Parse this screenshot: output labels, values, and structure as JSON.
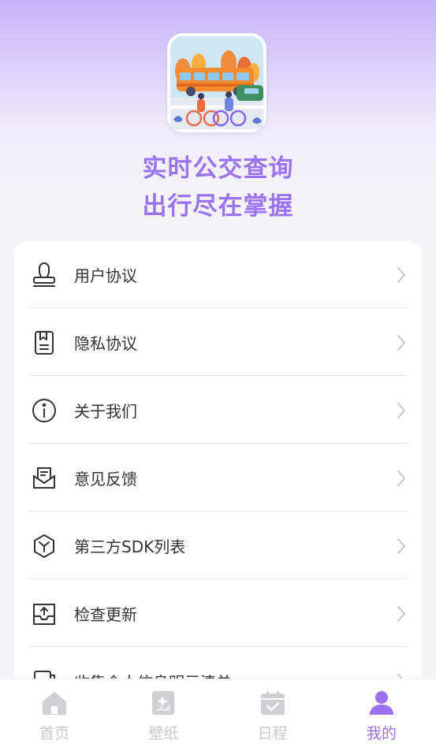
{
  "header": {
    "slogan_line1": "实时公交查询",
    "slogan_line2": "出行尽在掌握"
  },
  "menu": {
    "items": [
      {
        "label": "用户协议",
        "icon": "user-stamp-icon"
      },
      {
        "label": "隐私协议",
        "icon": "document-icon"
      },
      {
        "label": "关于我们",
        "icon": "info-icon"
      },
      {
        "label": "意见反馈",
        "icon": "feedback-mail-icon"
      },
      {
        "label": "第三方SDK列表",
        "icon": "cube-icon"
      },
      {
        "label": "检查更新",
        "icon": "upload-tray-icon"
      },
      {
        "label": "收集个人信息明示清单",
        "icon": "list-copy-icon"
      }
    ]
  },
  "tabbar": {
    "tabs": [
      {
        "label": "首页",
        "icon": "home-icon"
      },
      {
        "label": "壁纸",
        "icon": "wallpaper-icon"
      },
      {
        "label": "日程",
        "icon": "calendar-icon"
      },
      {
        "label": "我的",
        "icon": "profile-icon"
      }
    ],
    "active_tab": "我的"
  },
  "colors": {
    "accent": "#9a6ff0",
    "inactive": "#c8c8cc",
    "text": "#333333"
  }
}
